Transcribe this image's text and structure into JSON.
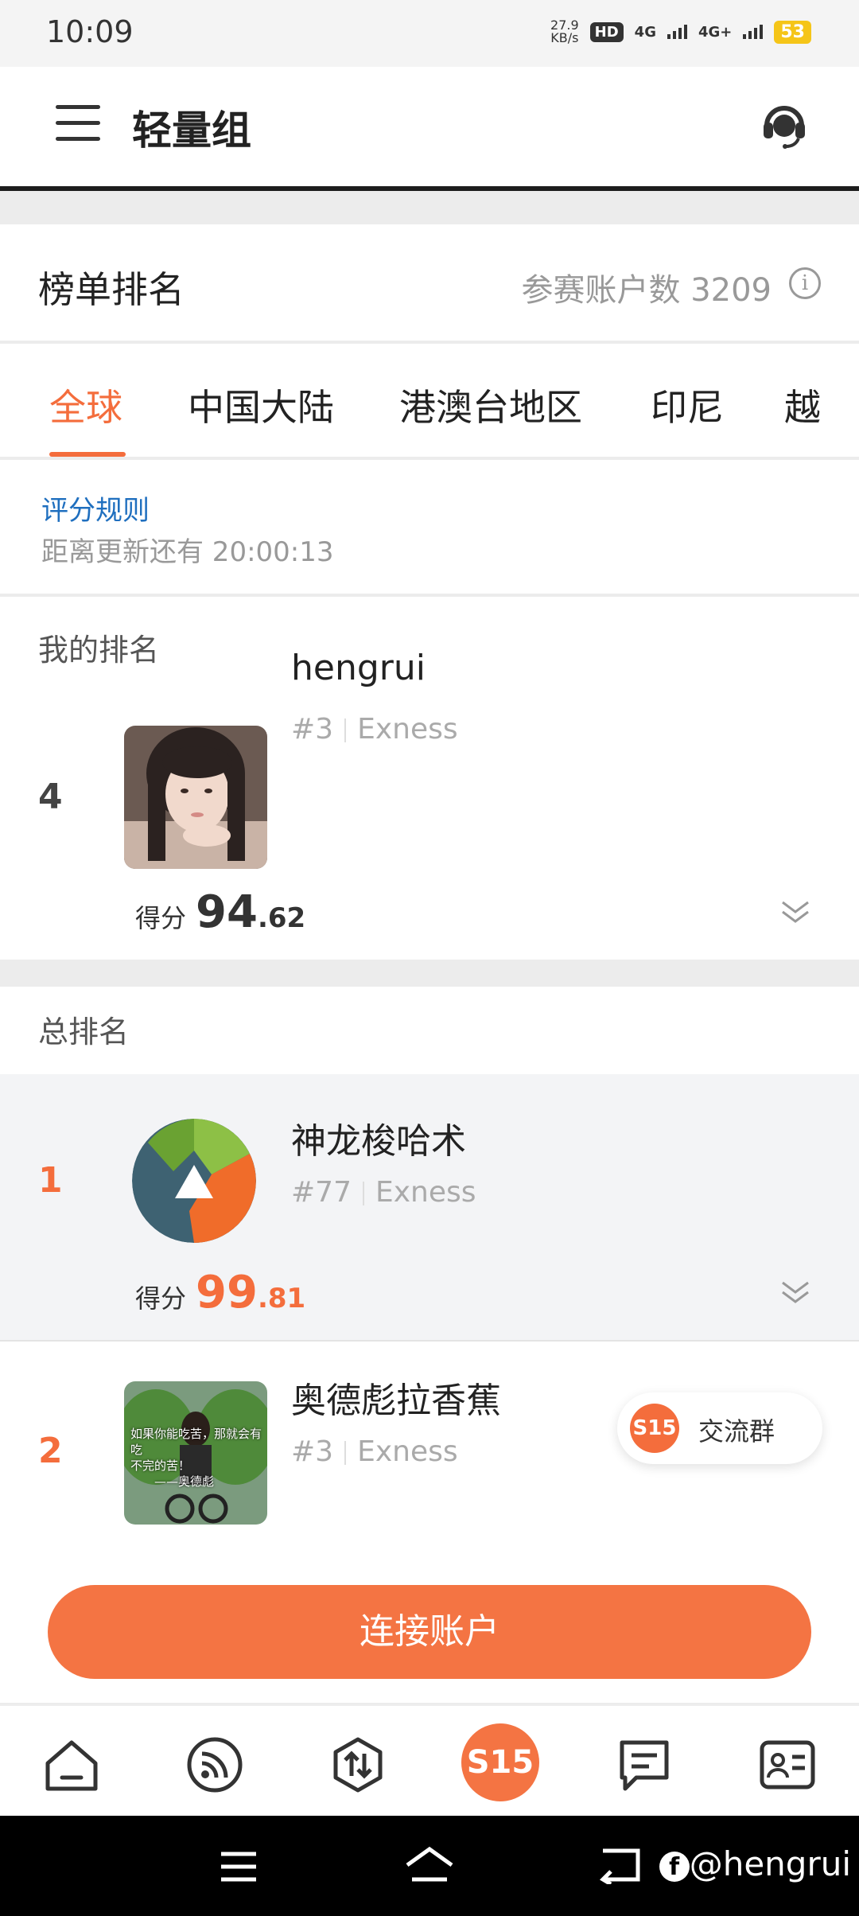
{
  "status_bar": {
    "time": "10:09",
    "speed_value": "27.9",
    "speed_unit": "KB/s",
    "hd_label": "HD",
    "net1": "4G",
    "net2": "4G+",
    "battery": "53"
  },
  "header": {
    "title": "轻量组",
    "menu_icon": "hamburger-icon",
    "support_icon": "headset-icon"
  },
  "ranking": {
    "label": "榜单排名",
    "participants_label": "参赛账户数 3209",
    "info_icon": "info-icon"
  },
  "tabs": [
    {
      "label": "全球",
      "active": true
    },
    {
      "label": "中国大陆",
      "active": false
    },
    {
      "label": "港澳台地区",
      "active": false
    },
    {
      "label": "印尼",
      "active": false
    },
    {
      "label": "越",
      "active": false
    }
  ],
  "rules": {
    "link": "评分规则",
    "countdown": "距离更新还有 20:00:13"
  },
  "my_rank": {
    "section_title": "我的排名",
    "rank": "4",
    "name": "hengrui",
    "account": "#3",
    "broker": "Exness",
    "score_label": "得分",
    "score_int": "94",
    "score_dec": ".62"
  },
  "total_rank": {
    "section_title": "总排名",
    "entries": [
      {
        "rank": "1",
        "name": "神龙梭哈术",
        "account": "#77",
        "broker": "Exness",
        "score_label": "得分",
        "score_int": "99",
        "score_dec": ".81"
      },
      {
        "rank": "2",
        "name": "奥德彪拉香蕉",
        "account": "#3",
        "broker": "Exness",
        "avatar_caption_1": "如果你能吃苦，那就会有吃",
        "avatar_caption_2": "不完的苦！",
        "avatar_caption_3": "——奥德彪"
      }
    ]
  },
  "float_group": {
    "logo": "S15",
    "label": "交流群"
  },
  "connect_button": "连接账户",
  "bottom_nav": {
    "center_logo": "S15",
    "icons": [
      "home-icon",
      "feed-icon",
      "trade-icon",
      "s15-icon",
      "message-icon",
      "profile-card-icon"
    ]
  },
  "watermark": "@hengrui",
  "colors": {
    "accent": "#f46d3c",
    "link": "#1f6fbf"
  }
}
